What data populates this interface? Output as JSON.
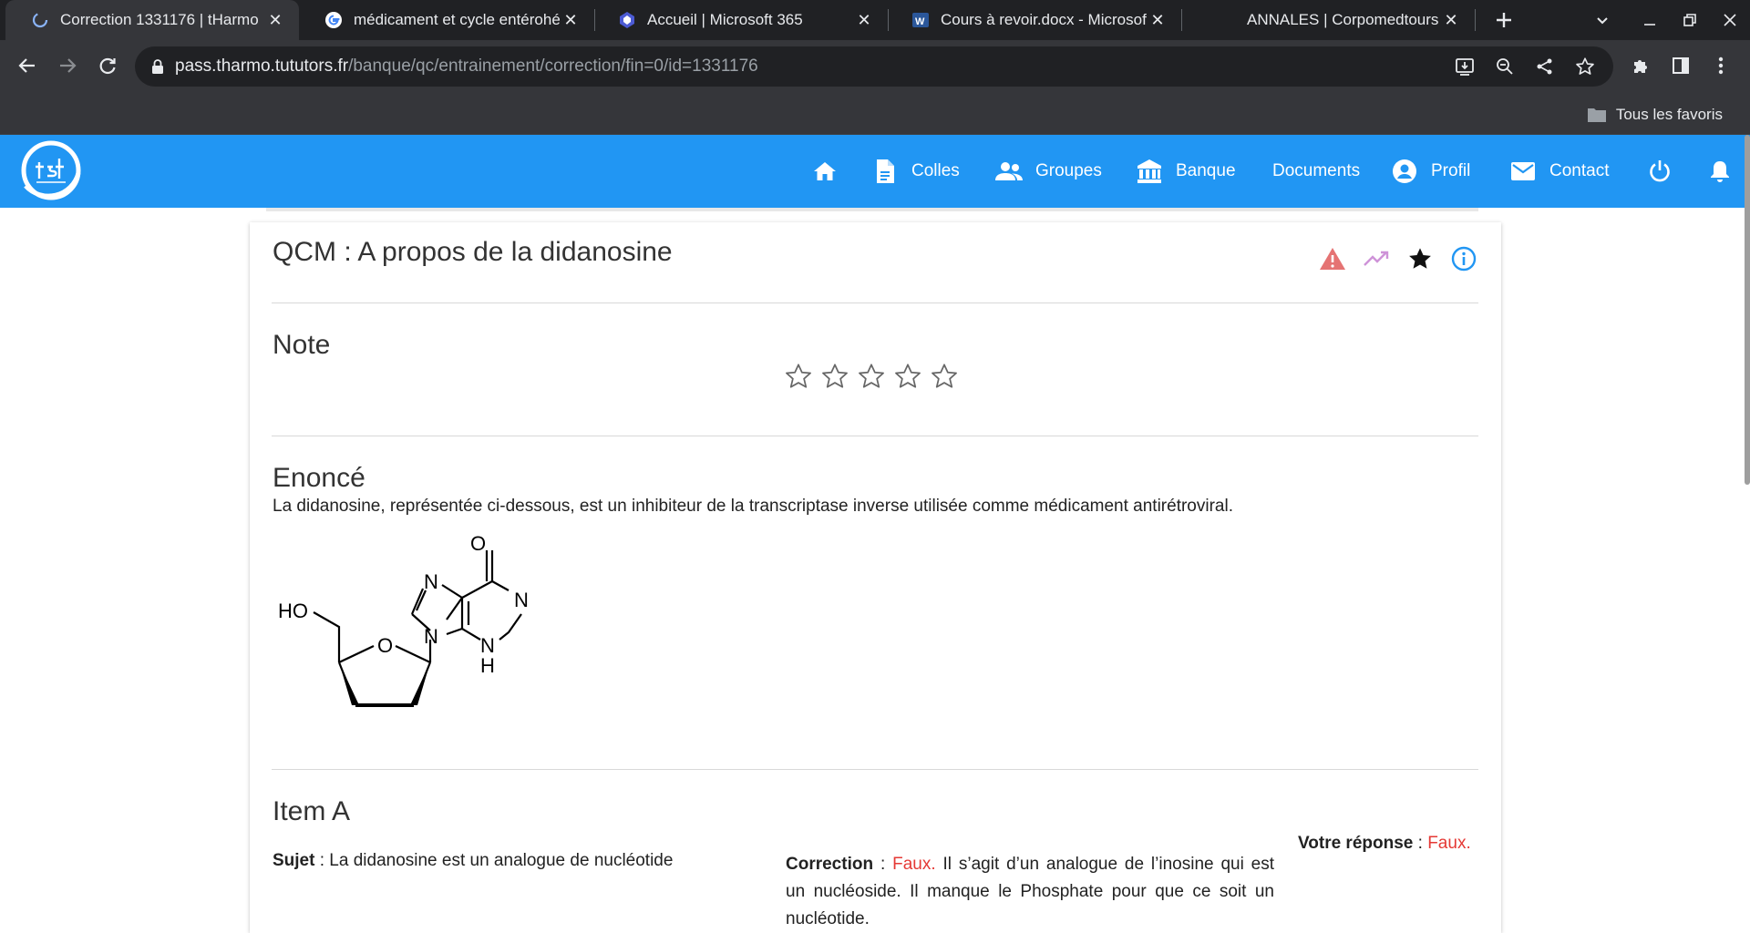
{
  "browser": {
    "tabs": [
      {
        "title": "Correction 1331176 | tHarmo",
        "icon": "loading-icon",
        "active": true
      },
      {
        "title": "médicament et cycle entérohépatique",
        "icon": "google-icon",
        "active": false
      },
      {
        "title": "Accueil | Microsoft 365",
        "icon": "microsoft365-icon",
        "active": false
      },
      {
        "title": "Cours à revoir.docx - Microsoft Word",
        "icon": "word-icon",
        "active": false
      },
      {
        "title": "ANNALES | Corpomedtours",
        "icon": "blank-icon",
        "active": false
      }
    ],
    "url_host": "pass.tharmo.tututors.fr",
    "url_path": "/banque/qc/entrainement/correction/fin=0/id=1331176",
    "bookmarks_label": "Tous les favoris"
  },
  "nav": {
    "items": [
      {
        "label": "",
        "icon": "home-icon"
      },
      {
        "label": "Colles",
        "icon": "document-icon"
      },
      {
        "label": "Groupes",
        "icon": "people-icon"
      },
      {
        "label": "Banque",
        "icon": "bank-icon"
      },
      {
        "label": "Documents",
        "icon": ""
      },
      {
        "label": "Profil",
        "icon": "account-icon"
      },
      {
        "label": "Contact",
        "icon": "mail-icon"
      },
      {
        "label": "",
        "icon": "power-icon"
      },
      {
        "label": "",
        "icon": "bell-icon"
      }
    ],
    "color": "#2196f3"
  },
  "qcm": {
    "title": "QCM : A propos de la didanosine",
    "header_icons": [
      "warning-icon",
      "trending-up-icon",
      "star-icon",
      "info-icon"
    ],
    "note_title": "Note",
    "rating": 0,
    "rating_max": 5,
    "enonce_title": "Enoncé",
    "enonce_text": "La didanosine, représentée ci-dessous, est un inhibiteur de la transcriptase inverse utilisée comme médicament antirétroviral.",
    "molecule_labels": {
      "oxygen_top": "O",
      "n1": "N",
      "n2": "N",
      "n3": "N",
      "nh_n": "N",
      "nh_h": "H",
      "ho": "HO",
      "ring_o": "O"
    },
    "item_title": "Item A",
    "sujet_label": "Sujet",
    "sujet_text": "La didanosine est un analogue de nucléotide",
    "correction_label": "Correction",
    "correction_verdict": "Faux.",
    "correction_text": "Il s’agit d’un analogue de l’inosine qui est un nucléoside. Il manque le Phosphate pour que ce soit un nucléotide.",
    "reponse_label": "Votre réponse",
    "reponse_value": "Faux."
  },
  "colors": {
    "false": "#e53935",
    "warning": "#e57373",
    "trend": "#ce93d8",
    "info": "#2196f3"
  }
}
